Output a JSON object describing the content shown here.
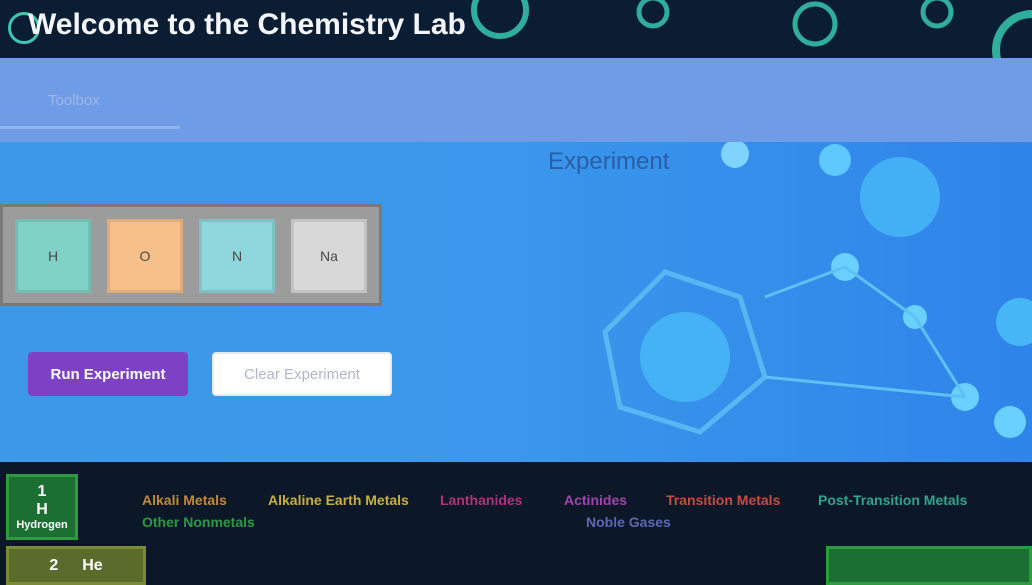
{
  "header": {
    "title": "Welcome to the Chemistry Lab"
  },
  "toolbar": {
    "tab_label": "Toolbox"
  },
  "main": {
    "heading": "Experiment",
    "tray_cells": [
      {
        "symbol": "H",
        "color": "#7fd2c5"
      },
      {
        "symbol": "O",
        "color": "#f5c08a"
      },
      {
        "symbol": "N",
        "color": "#8fd7dd"
      },
      {
        "symbol": "Na",
        "color": "#d8d8d8"
      }
    ],
    "run_button": "Run Experiment",
    "clear_button": "Clear Experiment"
  },
  "bottom": {
    "tiles": [
      {
        "number": "1",
        "symbol": "H",
        "name": "Hydrogen",
        "color": "#2d9c3e"
      },
      {
        "number": "2",
        "symbol": "He",
        "color": "#5b6b2c"
      }
    ],
    "categories": [
      {
        "label": "Alkali Metals",
        "color": "#c28a35"
      },
      {
        "label": "Alkaline Earth Metals",
        "color": "#c8b03b"
      },
      {
        "label": "Lanthanides",
        "color": "#b2317c"
      },
      {
        "label": "Actinides",
        "color": "#a144b2"
      },
      {
        "label": "Transition Metals",
        "color": "#c84a43"
      },
      {
        "label": "Post-Transition Metals",
        "color": "#2fa58c"
      },
      {
        "label": "Other Nonmetals",
        "color": "#2b9a46"
      },
      {
        "label": "Noble Gases",
        "color": "#5d67b3"
      }
    ]
  },
  "colors": {
    "header_bg": "#0b1d33",
    "toolbar_bg": "#6f9ce6",
    "main_bg": "#3d99e8",
    "accent_purple": "#7c41c4",
    "bottom_bg": "#0c1828"
  }
}
